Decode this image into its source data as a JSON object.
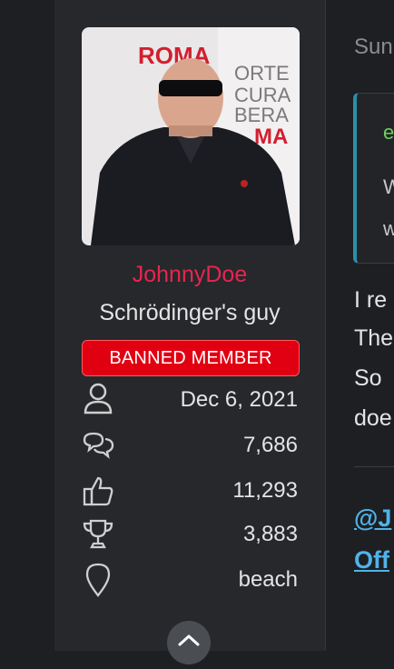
{
  "profile": {
    "username": "JohnnyDoe",
    "user_title": "Schrödinger's guy",
    "banner": "BANNED MEMBER",
    "avatar_text": {
      "line1": "ROMA",
      "line2": "ORTE",
      "line3": "CURA",
      "line4": "BERA",
      "line5": "MA"
    },
    "stats": [
      {
        "icon": "user-icon",
        "value": "Dec 6, 2021"
      },
      {
        "icon": "messages-icon",
        "value": "7,686"
      },
      {
        "icon": "thumbs-up-icon",
        "value": "11,293"
      },
      {
        "icon": "trophy-icon",
        "value": "3,883"
      },
      {
        "icon": "location-pin-icon",
        "value": "beach"
      }
    ]
  },
  "post": {
    "header_fragment": "Sun",
    "quote": {
      "author_fragment": "e",
      "line1_fragment": "W",
      "line2_fragment": "w"
    },
    "body_lines": [
      "I re",
      "The",
      "So",
      "doe"
    ],
    "mention_fragment": "@J",
    "link_fragment": "Off"
  },
  "colors": {
    "username": "#e8254f",
    "banner_bg": "#e00012",
    "link": "#4fb3e8",
    "quote_border": "#2a8fa8",
    "quote_author": "#6fcf5f"
  }
}
